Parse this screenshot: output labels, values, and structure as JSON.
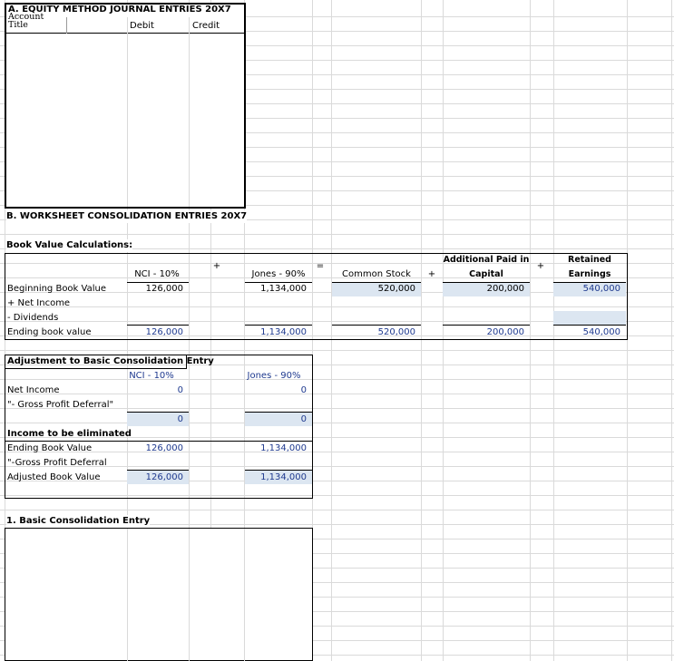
{
  "equity": {
    "title": "A. EQUITY METHOD JOURNAL ENTRIES  20X7",
    "account_title": "Account Title",
    "debit": "Debit",
    "credit": "Credit"
  },
  "worksheet": {
    "title": "B. WORKSHEET CONSOLIDATION ENTRIES 20X7"
  },
  "book_value": {
    "title": "Book Value Calculations:",
    "op_plus1": "+",
    "op_equals": "=",
    "op_plus2": "+",
    "op_plus3": "+",
    "headers": {
      "nci": "NCI - 10%",
      "jones": "Jones - 90%",
      "common": "Common Stock",
      "apic_1": "Additional Paid in",
      "apic_2": "Capital",
      "re_1": "Retained",
      "re_2": "Earnings"
    },
    "rows": {
      "beginning": "Beginning Book Value",
      "net_income": "+ Net Income",
      "dividends": "- Dividends",
      "ending": "Ending book value"
    },
    "values": {
      "beg_nci": "126,000",
      "beg_jones": "1,134,000",
      "beg_common": "520,000",
      "beg_apic": "200,000",
      "beg_re": "540,000",
      "end_nci": "126,000",
      "end_jones": "1,134,000",
      "end_common": "520,000",
      "end_apic": "200,000",
      "end_re": "540,000"
    }
  },
  "adjustment": {
    "title": "Adjustment to Basic Consolidation Entry",
    "nci": "NCI - 10%",
    "jones": "Jones - 90%",
    "top_nci": "0",
    "top_jones": "0",
    "net_income": "Net Income",
    "gross_profit_deferral": "\"- Gross Profit Deferral\"",
    "sub_nci": "0",
    "sub_jones": "0",
    "income_elim": "Income to be eliminated",
    "ending_bv": "Ending Book Value",
    "gross_profit_deferral2": "\"-Gross Profit Deferral",
    "adjusted_bv": "Adjusted Book Value",
    "end_nci": "126,000",
    "end_jones": "1,134,000",
    "adj_nci": "126,000",
    "adj_jones": "1,134,000"
  },
  "basic_entry": {
    "title": "1. Basic Consolidation Entry"
  }
}
